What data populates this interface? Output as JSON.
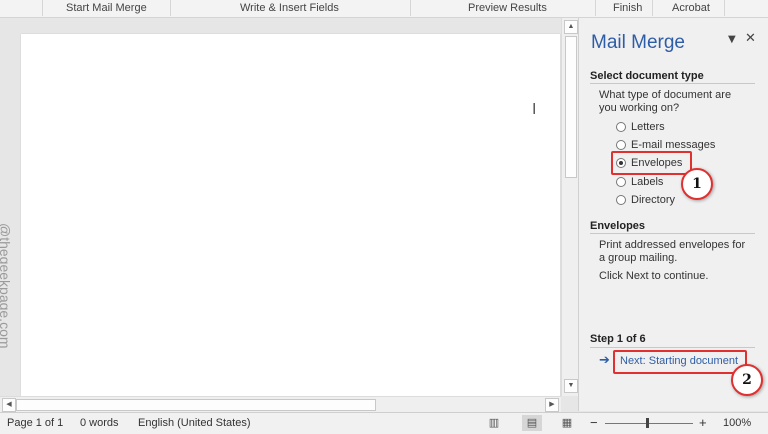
{
  "ribbon": {
    "groups": [
      "Start Mail Merge",
      "Write & Insert Fields",
      "Preview Results",
      "Finish",
      "Acrobat"
    ]
  },
  "document": {
    "watermark": "@thegeekpage.com"
  },
  "pane": {
    "title": "Mail Merge",
    "dropdown_icon": "triangle-down-icon",
    "close_icon": "close-icon",
    "section1_heading": "Select document type",
    "question": "What type of document are you working on?",
    "options": [
      "Letters",
      "E-mail messages",
      "Envelopes",
      "Labels",
      "Directory"
    ],
    "selected_option": "Envelopes",
    "section2_heading": "Envelopes",
    "description": "Print addressed envelopes for a group mailing.",
    "instruction": "Click Next to continue.",
    "step_label": "Step 1 of 6",
    "next_link": "Next: Starting document",
    "callouts": [
      "1",
      "2"
    ],
    "highlight_color": "#e03030",
    "accent_color": "#2e5da8"
  },
  "statusbar": {
    "page": "Page 1 of 1",
    "words": "0 words",
    "language": "English (United States)",
    "zoom_minus": "−",
    "zoom_plus": "+",
    "zoom": "100%",
    "zoom_level_percent": 100
  }
}
